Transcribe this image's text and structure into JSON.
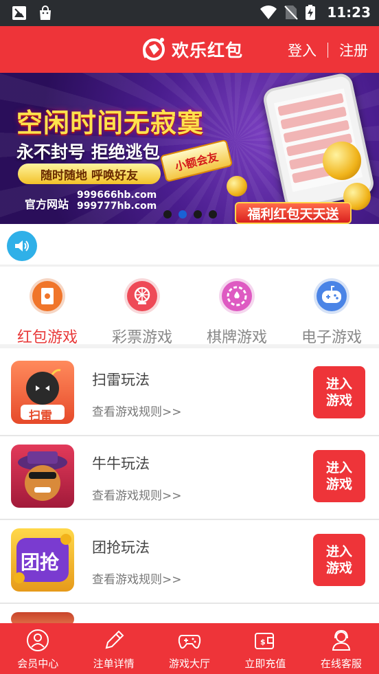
{
  "status_bar": {
    "time": "11:23",
    "left_icons": [
      "notification-image-icon",
      "shopping-bag-icon"
    ],
    "right_icons": [
      "wifi-icon",
      "no-sim-icon",
      "battery-charging-icon"
    ]
  },
  "header": {
    "brand": "欢乐红包",
    "login": "登入",
    "register": "注册",
    "accent_color": "#ee3439"
  },
  "banner": {
    "headline": "空闲时间无寂寞",
    "subline": "永不封号 拒绝逃包",
    "pill": "随时随地 呼唤好友",
    "badge": "小额会友",
    "site_label": "官方网站",
    "site_1": "999666hb.com",
    "site_2": "999777hb.com",
    "red_tag": "福利红包天天送",
    "slides": 4,
    "active_slide": 2
  },
  "notice": {
    "icon": "speaker-icon"
  },
  "categories": [
    {
      "label": "红包游戏",
      "icon": "red-envelope-icon",
      "active": true
    },
    {
      "label": "彩票游戏",
      "icon": "lottery-wheel-icon",
      "active": false
    },
    {
      "label": "棋牌游戏",
      "icon": "poker-chip-icon",
      "active": false
    },
    {
      "label": "电子游戏",
      "icon": "gamepad-icon",
      "active": false
    }
  ],
  "games": [
    {
      "name": "扫雷玩法",
      "rules": "查看游戏规则>>",
      "enter": "进入游戏",
      "thumb_text": "扫雷"
    },
    {
      "name": "牛牛玩法",
      "rules": "查看游戏规则>>",
      "enter": "进入游戏"
    },
    {
      "name": "团抢玩法",
      "rules": "查看游戏规则>>",
      "enter": "进入游戏",
      "thumb_text": "团抢"
    }
  ],
  "bottom_nav": [
    {
      "label": "会员中心",
      "icon": "user-icon"
    },
    {
      "label": "注单详情",
      "icon": "pencil-icon"
    },
    {
      "label": "游戏大厅",
      "icon": "gamepad-icon"
    },
    {
      "label": "立即充值",
      "icon": "wallet-icon"
    },
    {
      "label": "在线客服",
      "icon": "support-agent-icon"
    }
  ]
}
